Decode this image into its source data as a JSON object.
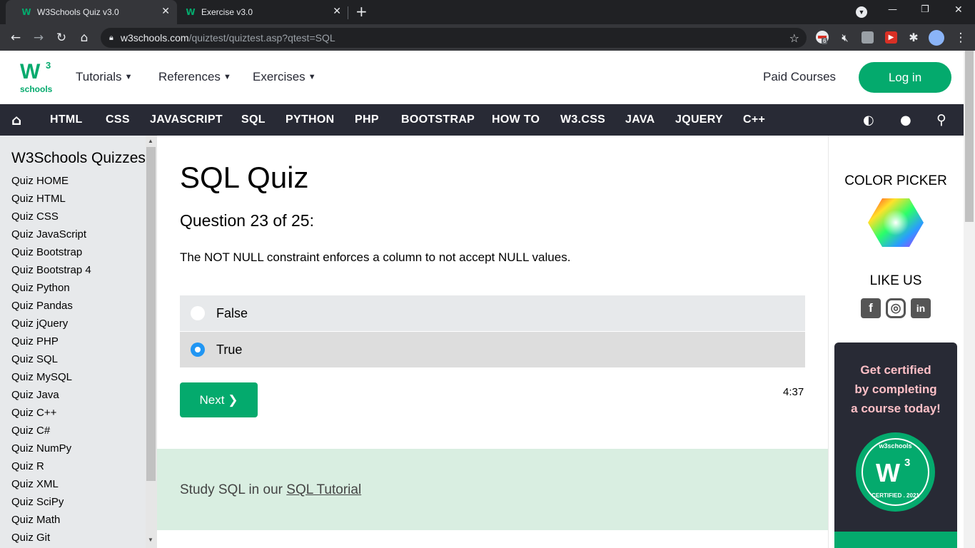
{
  "browser": {
    "tabs": [
      {
        "title": "W3Schools Quiz v3.0",
        "active": true
      },
      {
        "title": "Exercise v3.0",
        "active": false
      }
    ],
    "url_host": "w3schools.com",
    "url_path": "/quiztest/quiztest.asp?qtest=SQL",
    "extension_badge": "6"
  },
  "header": {
    "logo_mark": "W",
    "logo_sup": "3",
    "logo_text": "schools",
    "nav": [
      "Tutorials",
      "References",
      "Exercises"
    ],
    "paid_courses": "Paid Courses",
    "login": "Log in"
  },
  "menu": [
    "HTML",
    "CSS",
    "JAVASCRIPT",
    "SQL",
    "PYTHON",
    "PHP",
    "BOOTSTRAP",
    "HOW TO",
    "W3.CSS",
    "JAVA",
    "JQUERY",
    "C++"
  ],
  "sidebar": {
    "title": "W3Schools Quizzes",
    "items": [
      "Quiz HOME",
      "Quiz HTML",
      "Quiz CSS",
      "Quiz JavaScript",
      "Quiz Bootstrap",
      "Quiz Bootstrap 4",
      "Quiz Python",
      "Quiz Pandas",
      "Quiz jQuery",
      "Quiz PHP",
      "Quiz SQL",
      "Quiz MySQL",
      "Quiz Java",
      "Quiz C++",
      "Quiz C#",
      "Quiz NumPy",
      "Quiz R",
      "Quiz XML",
      "Quiz SciPy",
      "Quiz Math",
      "Quiz Git"
    ]
  },
  "quiz": {
    "title": "SQL Quiz",
    "question_header": "Question 23 of 25:",
    "question_text": "The NOT NULL constraint enforces a column to not accept NULL values.",
    "options": [
      {
        "label": "False",
        "selected": false
      },
      {
        "label": "True",
        "selected": true
      }
    ],
    "next_label": "Next ❯",
    "timer": "4:37",
    "study_prefix": "Study SQL in our ",
    "study_link": "SQL Tutorial"
  },
  "right_panel": {
    "color_picker": "COLOR PICKER",
    "like_us": "LIKE US",
    "cert_line1": "Get certified",
    "cert_line2": "by completing",
    "cert_line3": "a course today!",
    "badge_top": "w3schools",
    "badge_mark": "W",
    "badge_sup": "3",
    "badge_bottom": "CERTIFIED . 2021"
  },
  "colors": {
    "brand_green": "#04AA6D",
    "menu_dark": "#282A35",
    "sidebar_bg": "#E7E9EB",
    "study_bg": "#D9EEE1",
    "cert_text": "#FFC0C7",
    "radio_selected": "#2196F3"
  }
}
